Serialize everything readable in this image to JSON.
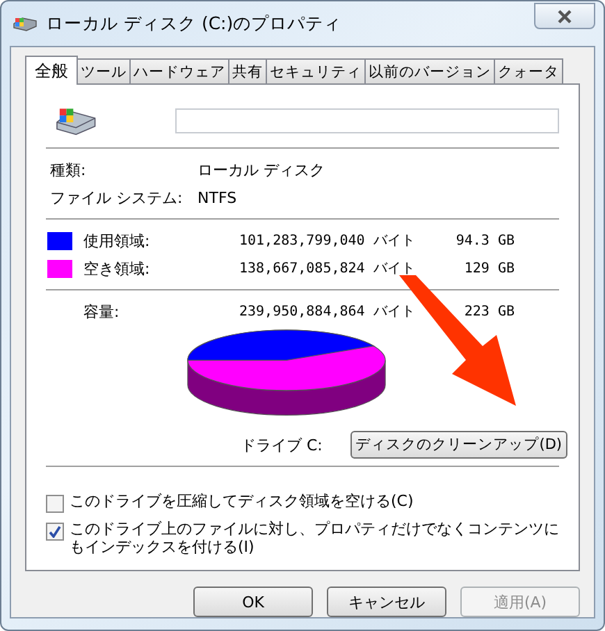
{
  "window": {
    "title": "ローカル ディスク (C:)のプロパティ"
  },
  "tabs": [
    {
      "label": "全般",
      "selected": true
    },
    {
      "label": "ツール",
      "selected": false
    },
    {
      "label": "ハードウェア",
      "selected": false
    },
    {
      "label": "共有",
      "selected": false
    },
    {
      "label": "セキュリティ",
      "selected": false
    },
    {
      "label": "以前のバージョン",
      "selected": false
    },
    {
      "label": "クォータ",
      "selected": false
    }
  ],
  "info": [
    {
      "label": "種類:",
      "value": "ローカル ディスク"
    },
    {
      "label": "ファイル システム:",
      "value": "NTFS"
    }
  ],
  "usage": [
    {
      "label": "使用領域:",
      "bytes": "101,283,799,040 バイト",
      "size": "94.3 GB",
      "color": "#0000ff"
    },
    {
      "label": "空き領域:",
      "bytes": "138,667,085,824 バイト",
      "size": "129 GB",
      "color": "#ff00ff"
    }
  ],
  "capacity": {
    "label": "容量:",
    "bytes": "239,950,884,864 バイト",
    "size": "223 GB"
  },
  "drive_label": "ドライブ C:",
  "cleanup_button": "ディスクのクリーンアップ(D)",
  "options": [
    {
      "label": "このドライブを圧縮してディスク領域を空ける(C)",
      "checked": false
    },
    {
      "label": "このドライブ上のファイルに対し、プロパティだけでなくコンテンツにもインデックスを付ける(I)",
      "checked": true
    }
  ],
  "buttons": [
    {
      "label": "OK",
      "disabled": false
    },
    {
      "label": "キャンセル",
      "disabled": false
    },
    {
      "label": "適用(A)",
      "disabled": true
    }
  ]
}
